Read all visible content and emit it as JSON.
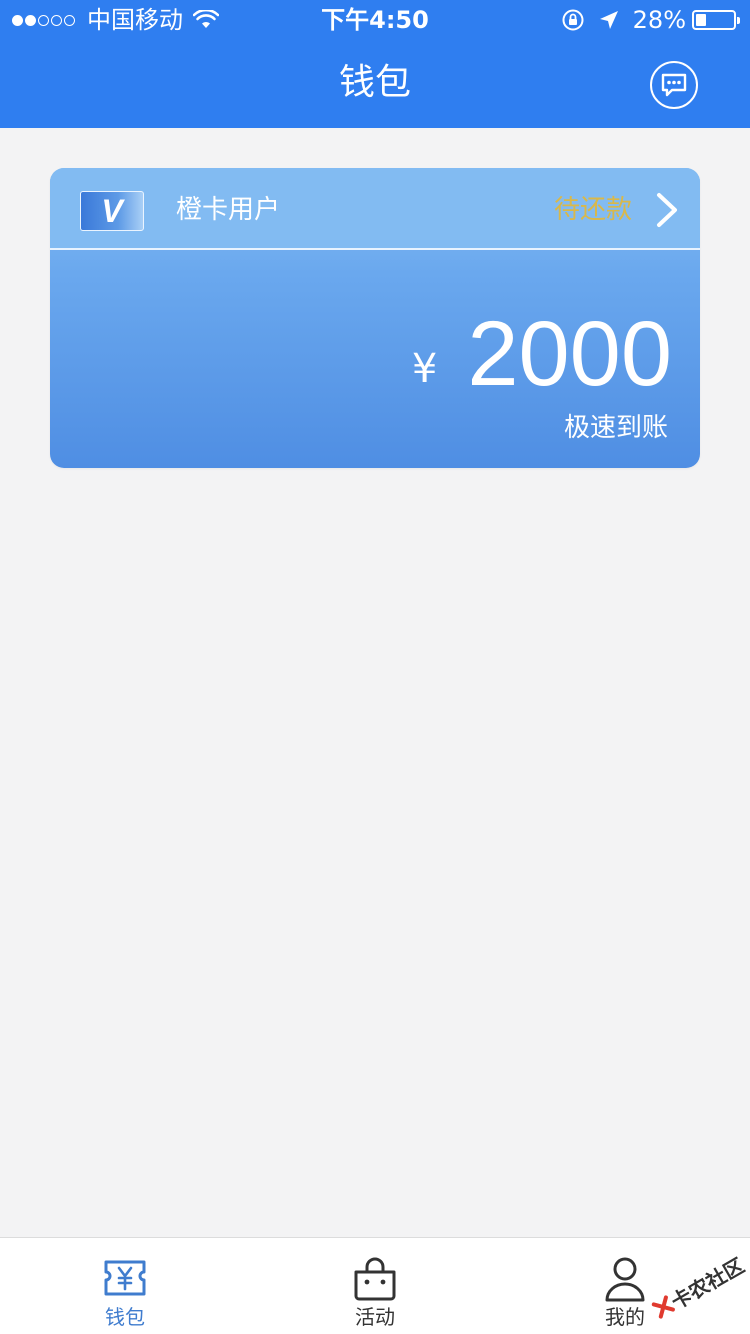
{
  "status_bar": {
    "carrier": "中国移动",
    "time": "下午4:50",
    "battery": "28%",
    "signal_bars_filled": 2,
    "signal_bars_total": 5
  },
  "nav": {
    "title": "钱包",
    "message_icon": "chat-bubble-icon"
  },
  "card": {
    "logo_letter": "V",
    "user_name": "橙卡用户",
    "status": "待还款",
    "currency": "¥",
    "amount": "2000",
    "subtitle": "极速到账"
  },
  "tabs": [
    {
      "label": "钱包",
      "icon": "wallet-icon",
      "active": true
    },
    {
      "label": "活动",
      "icon": "shopping-bag-icon",
      "active": false
    },
    {
      "label": "我的",
      "icon": "user-icon",
      "active": false
    }
  ],
  "watermark": {
    "text": "卡农社区"
  },
  "colors": {
    "nav_bg": "#2f7ef0",
    "page_bg": "#f3f3f4",
    "card_status": "#d9b84a",
    "tab_active": "#3f7cce"
  }
}
